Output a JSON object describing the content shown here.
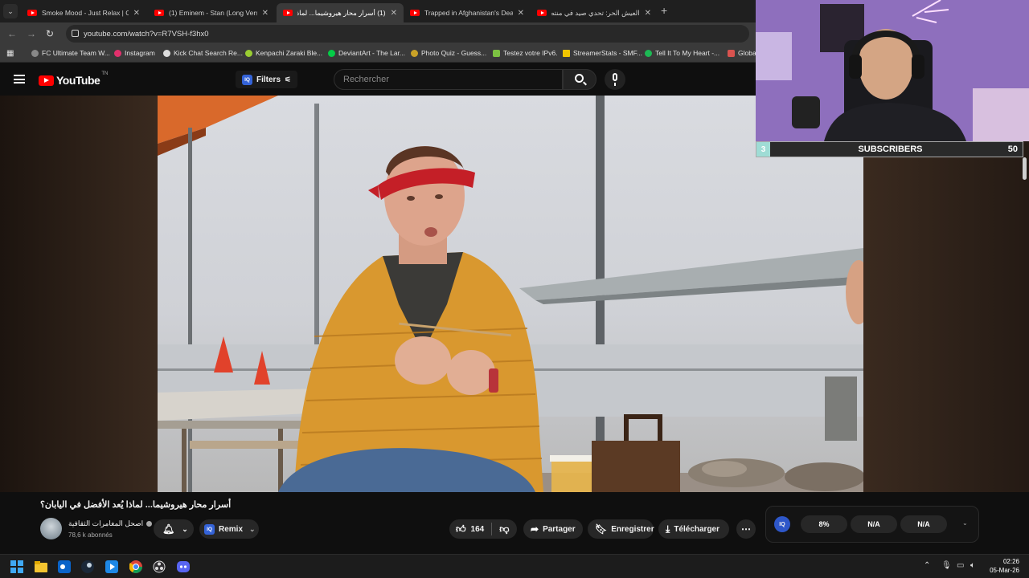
{
  "browser": {
    "tabs": [
      {
        "label": "Smoke Mood - Just Relax | Chi",
        "active": false
      },
      {
        "label": "(1) Eminem - Stan (Long Versio",
        "active": false
      },
      {
        "label": "(1) أسرار محار هيروشيما... لماذا يُ",
        "active": true
      },
      {
        "label": "Trapped in Afghanistan's Dead",
        "active": false
      },
      {
        "label": "العيش الحر: تحدي صيد في منتص",
        "active": false
      }
    ],
    "url": "youtube.com/watch?v=R7VSH-f3hx0",
    "bookmarks": [
      {
        "label": "FC Ultimate Team W...",
        "color": "#888888"
      },
      {
        "label": "Instagram",
        "color": "#e1306c"
      },
      {
        "label": "Kick Chat Search Re...",
        "color": "#dddddd"
      },
      {
        "label": "Kenpachi Zaraki Ble...",
        "color": "#9acd32"
      },
      {
        "label": "DeviantArt - The Lar...",
        "color": "#05cc47"
      },
      {
        "label": "Photo Quiz - Guess...",
        "color": "#c9a227"
      },
      {
        "label": "Testez votre IPv6.",
        "color": "#7cc242"
      },
      {
        "label": "StreamerStats - SMF...",
        "color": "#f0c400"
      },
      {
        "label": "Tell It To My Heart -...",
        "color": "#1db954"
      },
      {
        "label": "Globa",
        "color": "#d9534f"
      }
    ]
  },
  "youtube": {
    "logo_text": "YouTube",
    "logo_region": "TN",
    "filters_label": "Filters",
    "search_placeholder": "Rechercher",
    "video_title": "أسرار محار هيروشيما... لماذا يُعد الأفضل في اليابان؟",
    "channel_name": "اصحل المغامرات الثقافية",
    "subscribers": "78,6 k abonnés",
    "remix_label": "Remix",
    "likes": "164",
    "share_label": "Partager",
    "save_label": "Enregistrer",
    "download_label": "Télécharger",
    "stats": [
      "8%",
      "N/A",
      "N/A"
    ]
  },
  "overlay": {
    "sub_count": "3",
    "sub_label": "SUBSCRIBERS",
    "sub_goal": "50"
  },
  "taskbar": {
    "time": "02:26",
    "date": "05-Mar-26"
  }
}
